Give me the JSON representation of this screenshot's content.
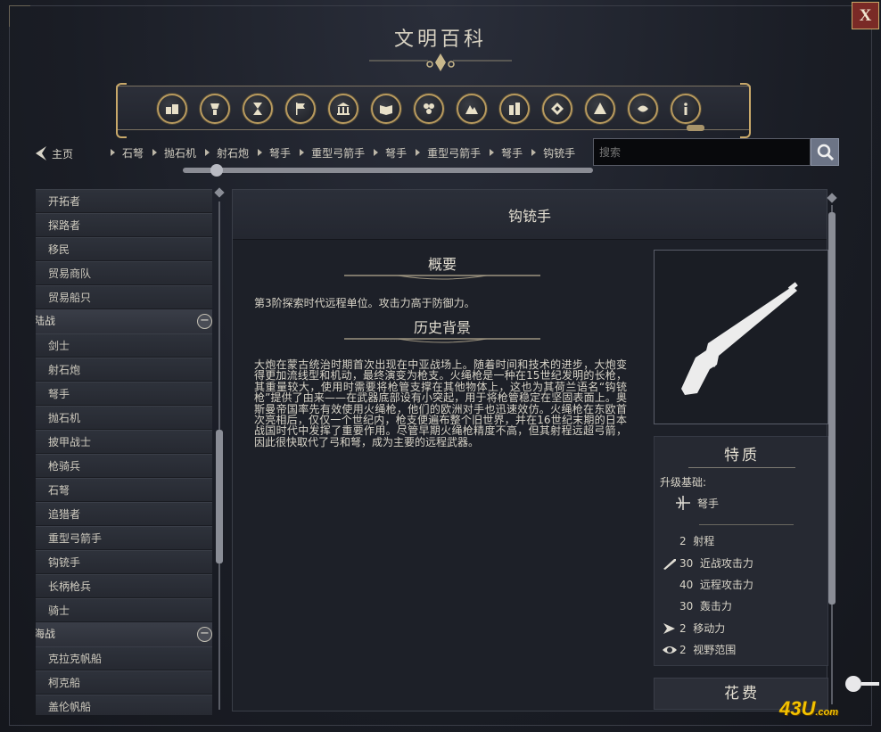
{
  "window": {
    "title": "文明百科",
    "close_label": "X"
  },
  "nav": {
    "home_label": "主页",
    "breadcrumbs": [
      "石弩",
      "抛石机",
      "射石炮",
      "弩手",
      "重型弓箭手",
      "弩手",
      "重型弓箭手",
      "弩手",
      "钩铳手"
    ]
  },
  "search": {
    "placeholder": "搜索"
  },
  "categories": [
    "建筑",
    "资源",
    "沙漏",
    "旗帜",
    "政体",
    "书籍",
    "科技",
    "地形",
    "城镇",
    "图腾",
    "奇观",
    "文明",
    "信息"
  ],
  "sidebar": {
    "items_top": [
      "开拓者",
      "探路者",
      "移民",
      "贸易商队",
      "贸易船只"
    ],
    "group_land": "陆战",
    "land_items": [
      "剑士",
      "射石炮",
      "弩手",
      "抛石机",
      "披甲战士",
      "枪骑兵",
      "石弩",
      "追猎者",
      "重型弓箭手",
      "钩铳手",
      "长柄枪兵",
      "骑士"
    ],
    "group_sea": "海战",
    "sea_items": [
      "克拉克帆船",
      "柯克船",
      "盖伦帆船"
    ],
    "toggle": "−"
  },
  "unit": {
    "name": "钩铳手",
    "summary_title": "概要",
    "summary_text": "第3阶探索时代远程单位。攻击力高于防御力。",
    "history_title": "历史背景",
    "history_text": "大炮在蒙古统治时期首次出现在中亚战场上。随着时间和技术的进步，大炮变得更加流线型和机动，最终演变为枪支。火绳枪是一种在15世纪发明的长枪，其重量较大，使用时需要将枪管支撑在其他物体上，这也为其荷兰语名“钩铳枪”提供了由来——在武器底部设有小突起，用于将枪管稳定在坚固表面上。奥斯曼帝国率先有效使用火绳枪，他们的欧洲对手也迅速效仿。火绳枪在东欧首次亮相后，仅仅一个世纪内，枪支便遍布整个旧世界，并在16世纪末期的日本战国时代中发挥了重要作用。尽管早期火绳枪精度不高，但其射程远超弓箭，因此很快取代了弓和弩，成为主要的远程武器。"
  },
  "traits": {
    "title": "特质",
    "upgrade_label": "升级基础:",
    "upgrade_from": "弩手",
    "stats": [
      {
        "icon": "",
        "value": "2",
        "label": "射程"
      },
      {
        "icon": "sword-icon",
        "value": "30",
        "label": "近战攻击力"
      },
      {
        "icon": "",
        "value": "40",
        "label": "远程攻击力"
      },
      {
        "icon": "",
        "value": "30",
        "label": "轰击力"
      },
      {
        "icon": "arrow-icon",
        "value": "2",
        "label": "移动力"
      },
      {
        "icon": "eye-icon",
        "value": "2",
        "label": "视野范围"
      }
    ]
  },
  "cost": {
    "title": "花费"
  },
  "watermark": {
    "text": "43U",
    "suffix": ".com"
  }
}
